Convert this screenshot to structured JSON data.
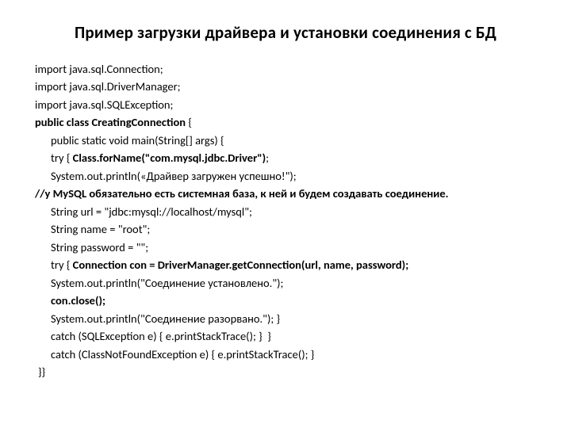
{
  "title": "Пример загрузки драйвера и установки соединения с БД",
  "lines": {
    "l0": "import java.sql.Connection;",
    "l1": "import java.sql.DriverManager;",
    "l2": "import java.sql.SQLException;",
    "l3_a": "public class CreatingConnection",
    "l3_b": " {",
    "l4": "public static void main(String[] args) {",
    "l5_a": "try { ",
    "l5_b": "Class.forName(\"com.mysql.jdbc.Driver\")",
    "l5_c": ";",
    "l6": "System.out.println(«Драйвер загружен успешно!\");",
    "l7": "//у MySQL обязательно есть системная база, к ней и будем создавать соединение.",
    "l8": "String url = \"jdbc:mysql://localhost/mysql\";",
    "l9": "String name = \"root\";",
    "l10": "String password = \"\";",
    "l11_a": "try { ",
    "l11_b": "Connection con = DriverManager.getConnection(url, name, password);",
    "l12": "System.out.println(\"Соединение установлено.\");",
    "l13": "con.close();",
    "l14": "System.out.println(\"Соединение разорвано.\"); }",
    "l15": "catch (SQLException e) { e.printStackTrace(); }  }",
    "l16": "catch (ClassNotFoundException e) { e.printStackTrace(); }",
    "l17": "}}"
  }
}
